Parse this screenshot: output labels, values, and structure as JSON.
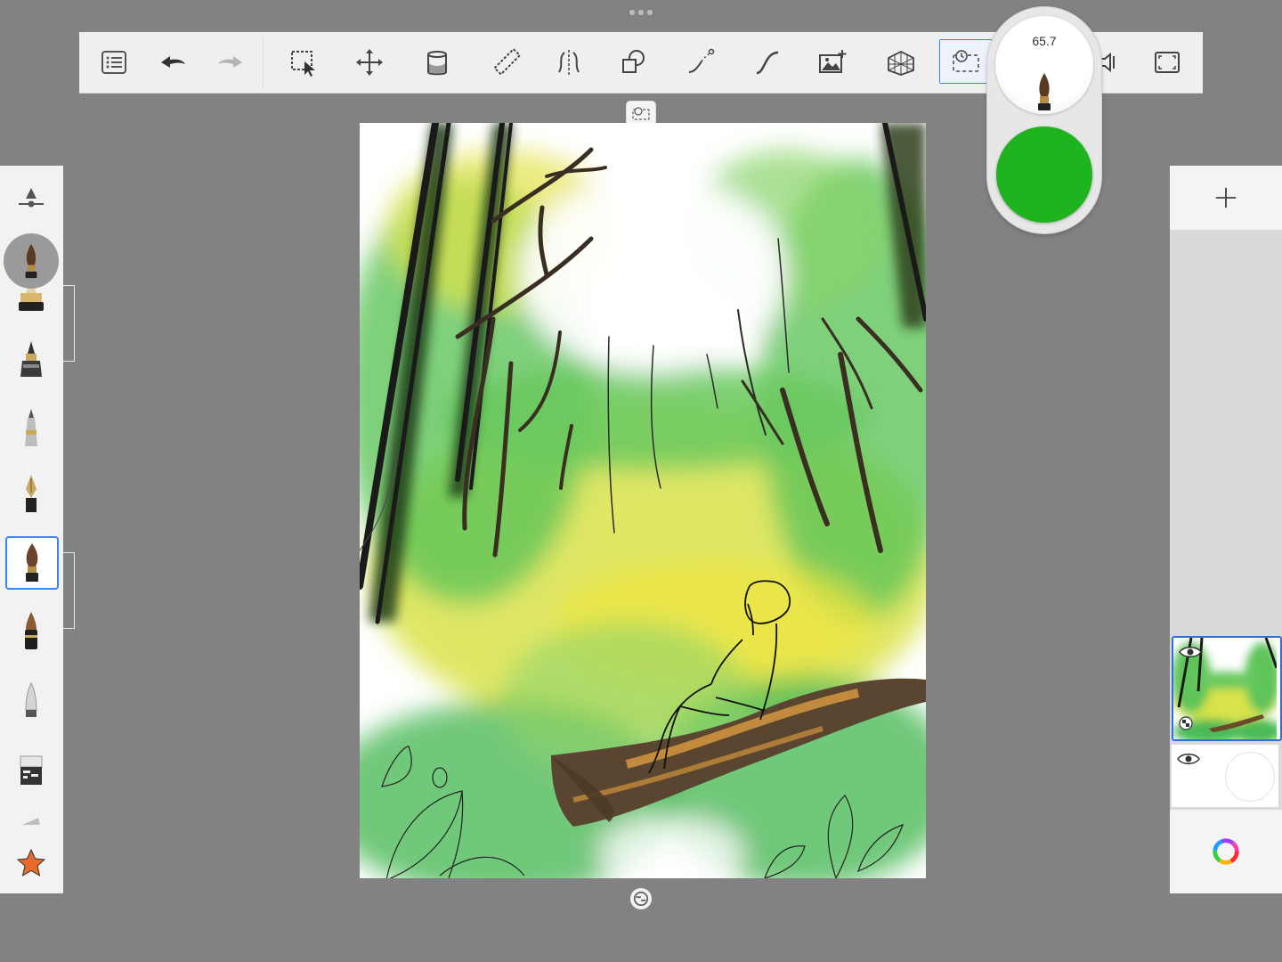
{
  "toolbar": {
    "tools": [
      {
        "name": "menu"
      },
      {
        "name": "undo"
      },
      {
        "name": "redo"
      },
      {
        "name": "selection"
      },
      {
        "name": "transform"
      },
      {
        "name": "fill"
      },
      {
        "name": "ruler"
      },
      {
        "name": "symmetry"
      },
      {
        "name": "shapes"
      },
      {
        "name": "stroke"
      },
      {
        "name": "predictive-stroke"
      },
      {
        "name": "add-image"
      },
      {
        "name": "perspective"
      },
      {
        "name": "time-lapse",
        "active": true
      },
      {
        "name": "record"
      },
      {
        "name": "fullscreen"
      }
    ]
  },
  "brush_puck": {
    "size_value": "65.7",
    "color": "#1fb31f"
  },
  "brush_palette": {
    "selected_index": 5,
    "items": [
      "brush-settings",
      "pencil",
      "inking-pen",
      "ballpoint",
      "fountain-pen",
      "paintbrush",
      "marker",
      "airbrush",
      "eraser",
      "smudge",
      "favorites"
    ]
  },
  "layers": {
    "count": 2,
    "selected_index": 0
  },
  "accent_color": "#2d6fdc"
}
